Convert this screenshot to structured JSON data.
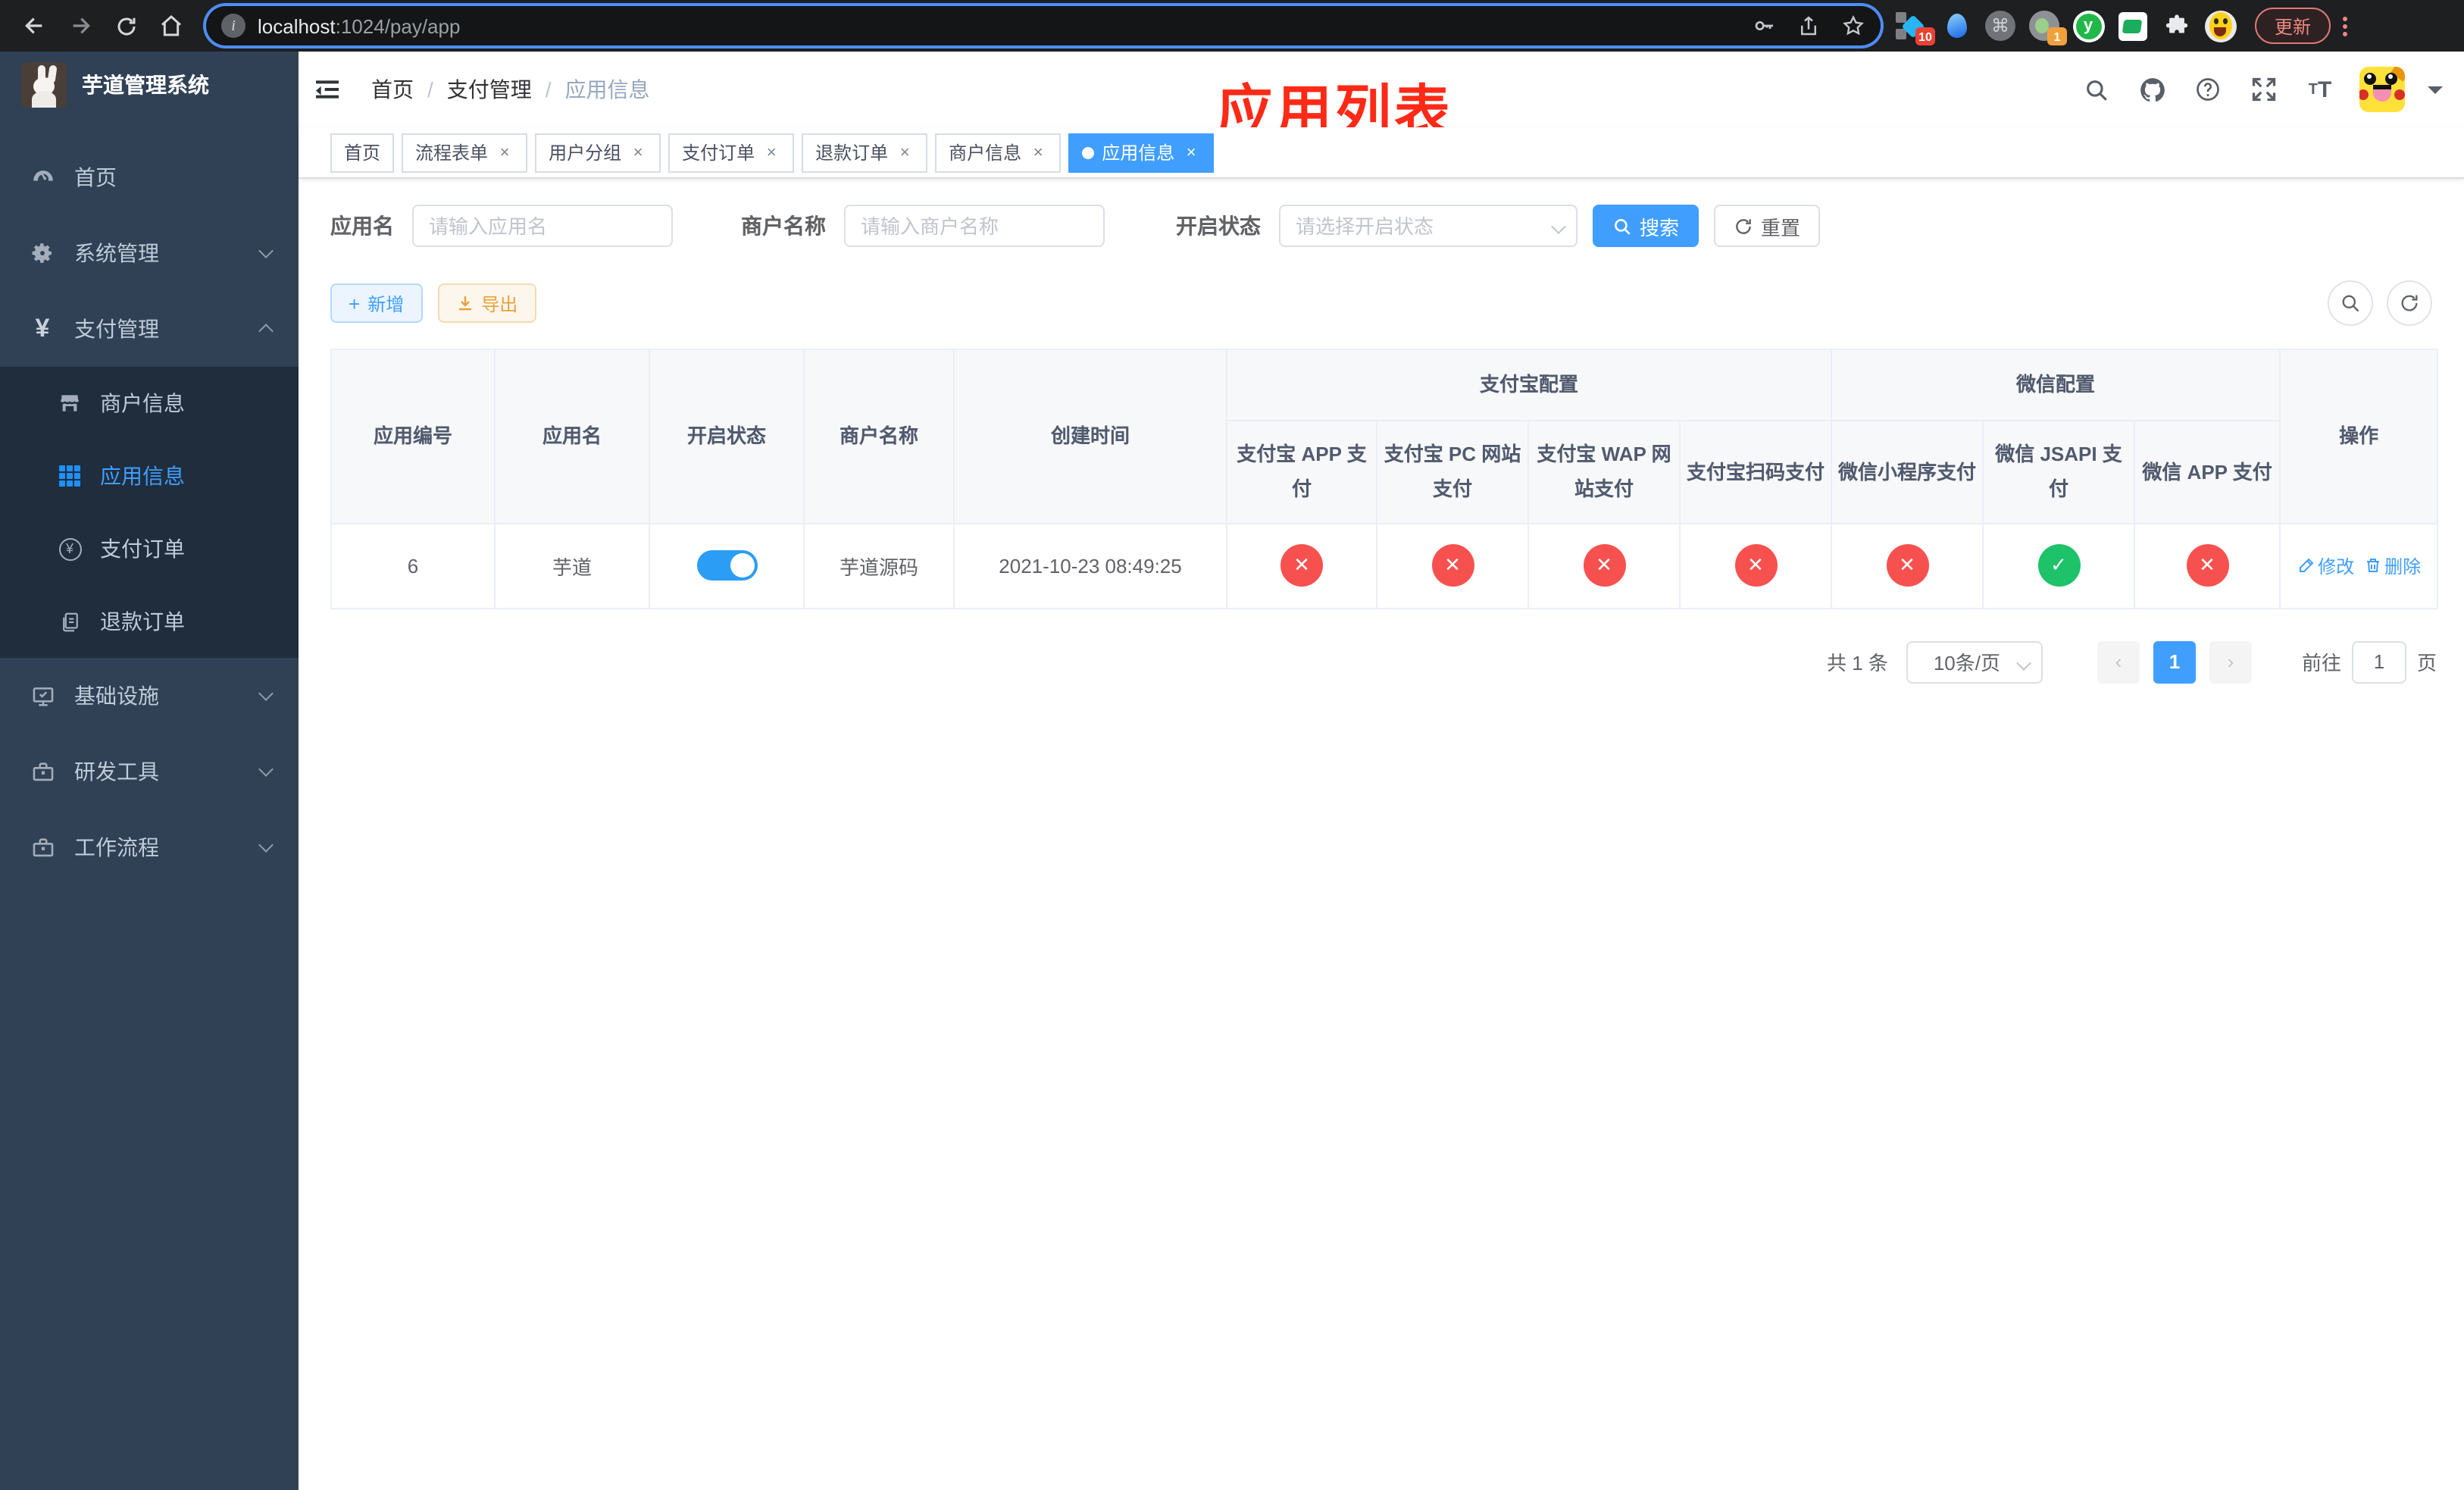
{
  "browser": {
    "url_host": "localhost",
    "url_rest": ":1024/pay/app",
    "ext_badge_pin": "10",
    "ext_badge_rec": "1",
    "update_label": "更新"
  },
  "sidebar": {
    "logo_title": "芋道管理系统",
    "menu": [
      {
        "label": "首页"
      },
      {
        "label": "系统管理"
      },
      {
        "label": "支付管理"
      },
      {
        "label": "基础设施"
      },
      {
        "label": "研发工具"
      },
      {
        "label": "工作流程"
      }
    ],
    "submenu": [
      {
        "label": "商户信息"
      },
      {
        "label": "应用信息"
      },
      {
        "label": "支付订单"
      },
      {
        "label": "退款订单"
      }
    ]
  },
  "breadcrumb": {
    "items": [
      "首页",
      "支付管理",
      "应用信息"
    ]
  },
  "annotation_title": "应用列表",
  "tabs": [
    {
      "label": "首页"
    },
    {
      "label": "流程表单"
    },
    {
      "label": "用户分组"
    },
    {
      "label": "支付订单"
    },
    {
      "label": "退款订单"
    },
    {
      "label": "商户信息"
    },
    {
      "label": "应用信息"
    }
  ],
  "filters": {
    "app_name_label": "应用名",
    "app_name_placeholder": "请输入应用名",
    "merchant_label": "商户名称",
    "merchant_placeholder": "请输入商户名称",
    "status_label": "开启状态",
    "status_placeholder": "请选择开启状态",
    "search_label": "搜索",
    "reset_label": "重置"
  },
  "toolbar": {
    "add_label": "新增",
    "export_label": "导出"
  },
  "table": {
    "headers": {
      "app_id": "应用编号",
      "app_name": "应用名",
      "status": "开启状态",
      "merchant": "商户名称",
      "created": "创建时间",
      "alipay_group": "支付宝配置",
      "wechat_group": "微信配置",
      "ops": "操作",
      "sub": [
        "支付宝 APP 支付",
        "支付宝 PC 网站支付",
        "支付宝 WAP 网站支付",
        "支付宝扫码支付",
        "微信小程序支付",
        "微信 JSAPI 支付",
        "微信 APP 支付"
      ]
    },
    "row": {
      "id": "6",
      "name": "芋道",
      "enabled": "on",
      "merchant": "芋道源码",
      "created": "2021-10-23 08:49:25",
      "statuses": [
        "no",
        "no",
        "no",
        "no",
        "no",
        "yes",
        "no"
      ],
      "edit_label": "修改",
      "delete_label": "删除"
    }
  },
  "pagination": {
    "total": "共 1 条",
    "page_size": "10条/页",
    "page": "1",
    "goto_prefix": "前往",
    "goto_value": "1",
    "goto_suffix": "页"
  }
}
